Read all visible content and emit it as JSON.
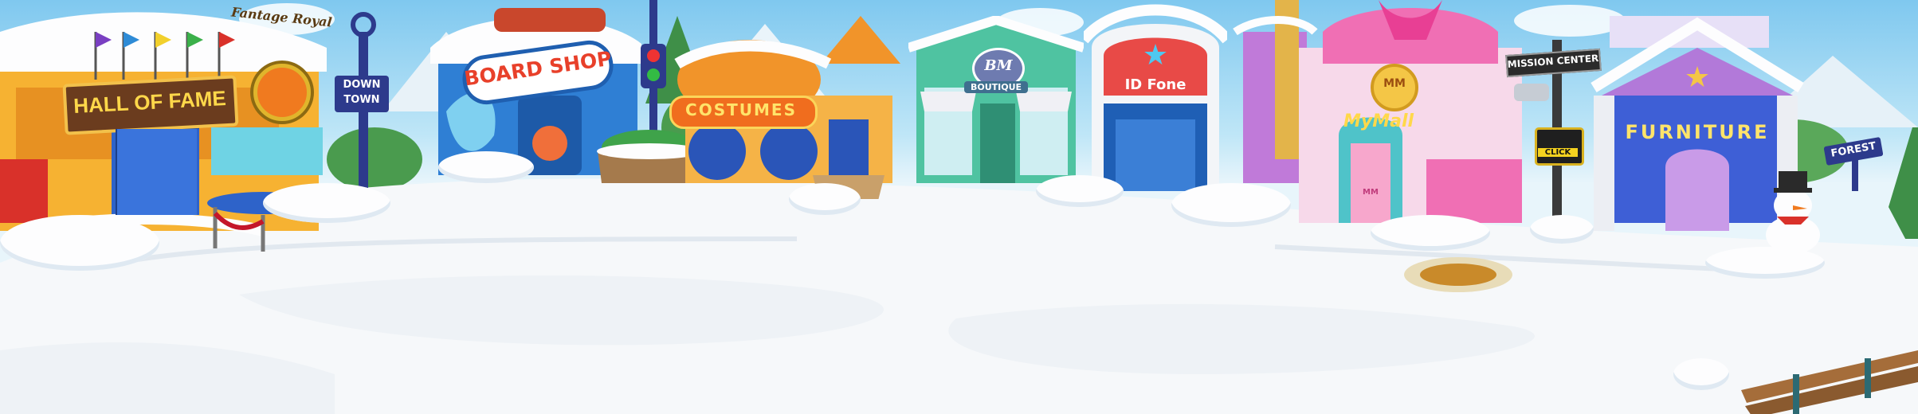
{
  "scene": {
    "hall_of_fame": {
      "name": "HALL OF FAME",
      "owner_sign": "Fantage Royal"
    },
    "downtown_sign": {
      "line1": "DOWN",
      "line2": "TOWN"
    },
    "board_shop": {
      "name": "BOARD SHOP"
    },
    "costumes": {
      "name": "COSTUMES"
    },
    "boutique": {
      "monogram": "BM",
      "name": "BOUTIQUE"
    },
    "idfone": {
      "name": "ID Fone"
    },
    "mymall": {
      "name": "MyMall",
      "monogram": "MM",
      "door_monogram": "MM"
    },
    "mission_center": {
      "sign": "MISSION CENTER",
      "button": "CLICK"
    },
    "furniture": {
      "name": "FURNITURE"
    },
    "forest_sign": {
      "label": "FOREST"
    }
  },
  "colors": {
    "sky": "#7fc8ef",
    "snow": "#fdfdfe",
    "hall_of_fame_sign": "#6b3c1e",
    "board_shop": "#2f7fd4",
    "costumes": "#f1942a",
    "boutique": "#4fc3a1",
    "idfone": "#e84a47",
    "mymall": "#f06fb4",
    "furniture": "#3e5fd6"
  }
}
